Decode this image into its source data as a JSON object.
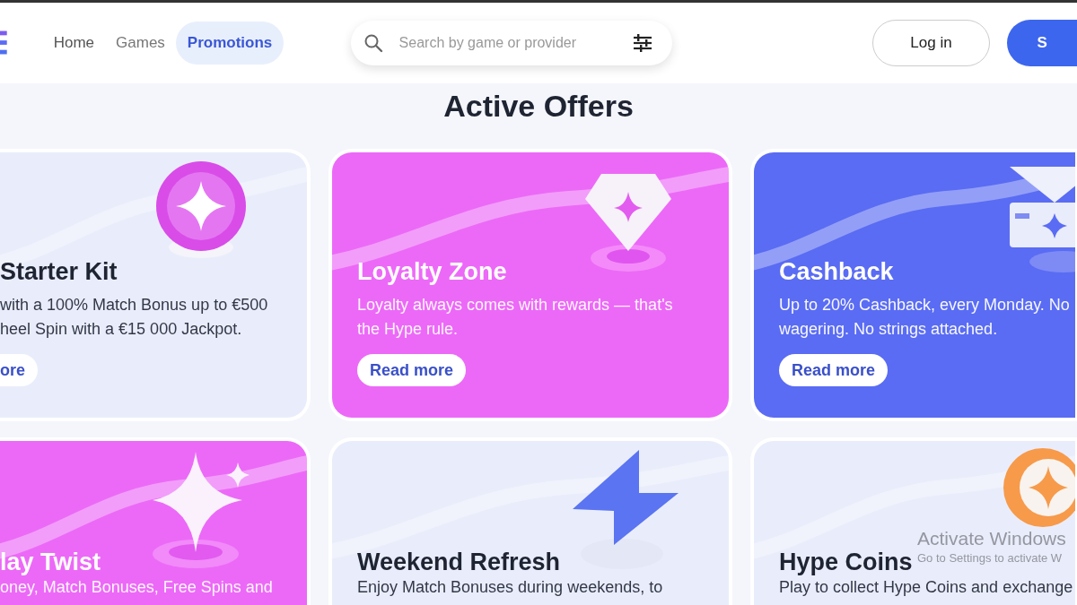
{
  "header": {
    "nav": [
      {
        "label": "Home",
        "selected": false
      },
      {
        "label": "Games",
        "selected": false
      },
      {
        "label": "Promotions",
        "selected": true
      }
    ],
    "search": {
      "placeholder": "Search by game or provider"
    },
    "login": "Log in",
    "signup": "S"
  },
  "title": "Active Offers",
  "offers": [
    {
      "color": "#e9edfb",
      "kind": "sparkle-coin",
      "title": "Starter Kit",
      "lines": [
        "with a 100% Match Bonus up to €500",
        "heel Spin with a €15 000 Jackpot."
      ],
      "button": "ore"
    },
    {
      "color": "#ec69f7",
      "kind": "diamond",
      "title": "Loyalty Zone",
      "lines": [
        "Loyalty always comes with rewards — that's",
        "the Hype rule."
      ],
      "button": "Read more"
    },
    {
      "color": "#5a6cf3",
      "kind": "ticket",
      "title": "Cashback",
      "lines": [
        "Up to 20% Cashback, every Monday. No",
        "wagering. No strings attached."
      ],
      "button": "Read more"
    },
    {
      "color": "#ec69f7",
      "kind": "sparkles",
      "title": "lay Twist",
      "lines": [
        "oney, Match Bonuses, Free Spins and"
      ]
    },
    {
      "color": "#e9edfb",
      "kind": "lightning",
      "title": "Weekend Refresh",
      "lines": [
        "Enjoy Match Bonuses during weekends, to"
      ]
    },
    {
      "color": "#e9edfb",
      "kind": "coin",
      "title": "Hype Coins",
      "lines": [
        "Play to collect Hype Coins and exchange"
      ]
    }
  ],
  "os_notice": {
    "title": "Activate Windows",
    "subtitle": "Go to Settings to activate W"
  }
}
